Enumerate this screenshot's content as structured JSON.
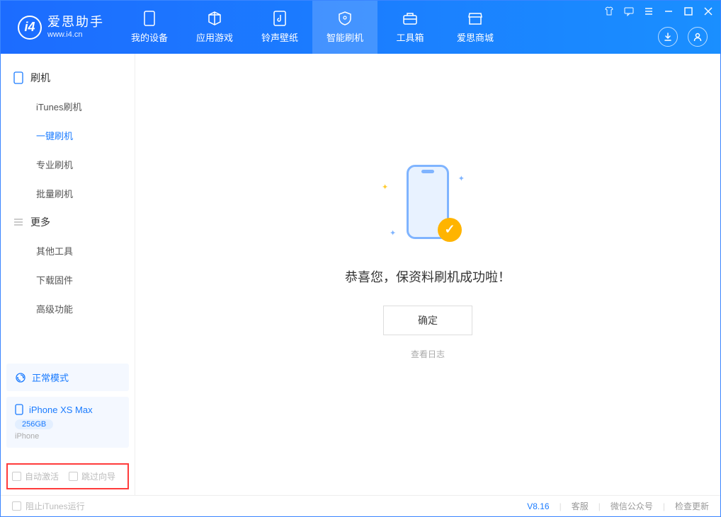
{
  "app": {
    "title": "爱思助手",
    "subtitle": "www.i4.cn"
  },
  "header": {
    "tabs": [
      {
        "label": "我的设备"
      },
      {
        "label": "应用游戏"
      },
      {
        "label": "铃声壁纸"
      },
      {
        "label": "智能刷机"
      },
      {
        "label": "工具箱"
      },
      {
        "label": "爱思商城"
      }
    ]
  },
  "sidebar": {
    "section1": "刷机",
    "items1": [
      "iTunes刷机",
      "一键刷机",
      "专业刷机",
      "批量刷机"
    ],
    "section2": "更多",
    "items2": [
      "其他工具",
      "下载固件",
      "高级功能"
    ],
    "mode_card": "正常模式",
    "device": {
      "name": "iPhone XS Max",
      "capacity": "256GB",
      "type": "iPhone"
    },
    "checkboxes": {
      "auto_activate": "自动激活",
      "skip_guide": "跳过向导"
    }
  },
  "main": {
    "success_message": "恭喜您，保资料刷机成功啦！",
    "confirm_button": "确定",
    "view_log": "查看日志"
  },
  "footer": {
    "block_itunes": "阻止iTunes运行",
    "version": "V8.16",
    "links": [
      "客服",
      "微信公众号",
      "检查更新"
    ]
  }
}
